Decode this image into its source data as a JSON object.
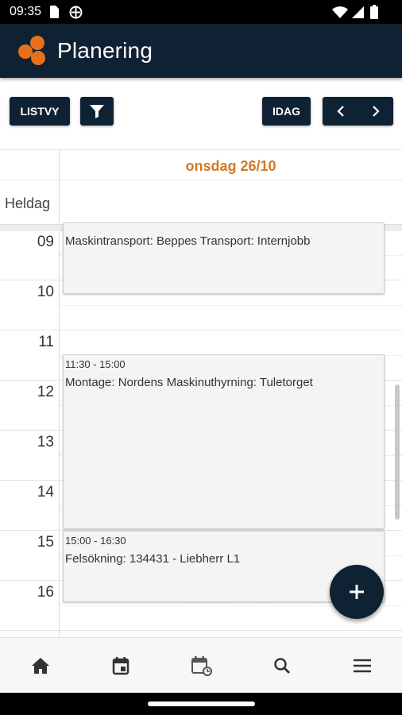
{
  "status_bar": {
    "time": "09:35"
  },
  "app_bar": {
    "title": "Planering"
  },
  "toolbar": {
    "list_view_label": "LISTVY",
    "today_label": "IDAG",
    "filter_icon": "filter-icon",
    "prev_icon": "chevron-left-icon",
    "next_icon": "chevron-right-icon"
  },
  "calendar": {
    "day_label": "onsdag 26/10",
    "all_day_label": "Heldag",
    "hours": [
      "09",
      "10",
      "11",
      "12",
      "13",
      "14",
      "15",
      "16"
    ],
    "events": [
      {
        "time": "",
        "title": "Maskintransport: Beppes Transport: Internjobb"
      },
      {
        "time": "11:30 - 15:00",
        "title": "Montage: Nordens Maskinuthyrning: Tuletorget"
      },
      {
        "time": "15:00 - 16:30",
        "title": "Felsökning: 134431 - Liebherr L1"
      }
    ]
  },
  "bottom_nav": {
    "items": [
      "home-icon",
      "calendar-today-icon",
      "calendar-sync-icon",
      "search-icon",
      "menu-icon"
    ]
  },
  "colors": {
    "primary": "#0f2234",
    "accent": "#e8701a",
    "day_label": "#cf7a24"
  }
}
